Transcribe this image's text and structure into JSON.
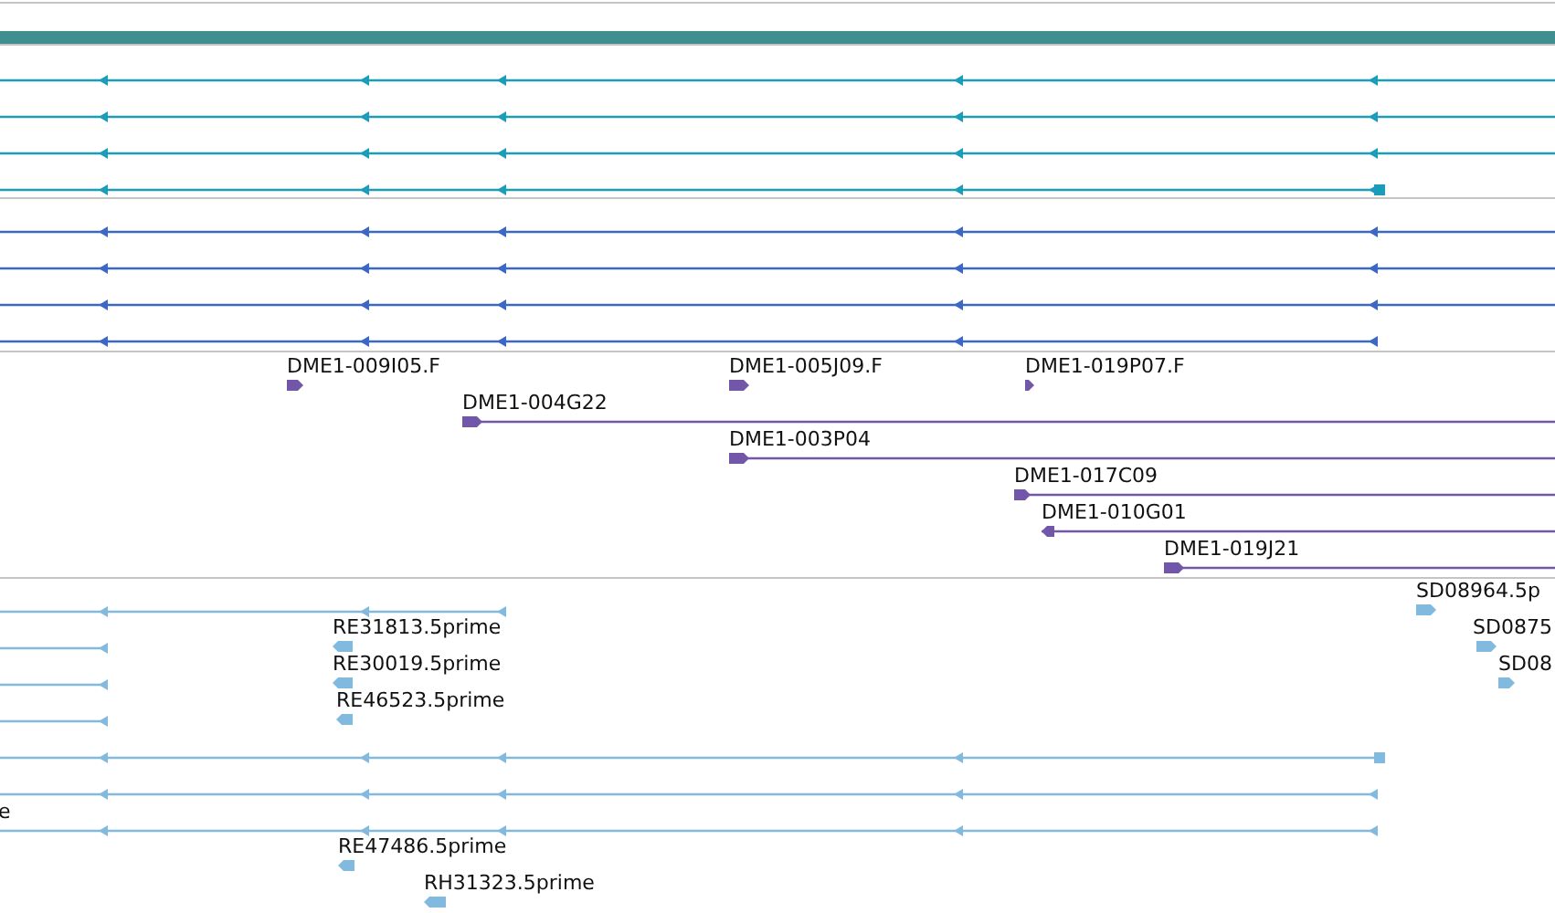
{
  "tracks": [
    {
      "color": "#1b9cb8",
      "features": [
        {
          "reverse": true
        },
        {
          "reverse": true
        },
        {
          "reverse": true
        },
        {
          "reverse": true
        }
      ]
    },
    {
      "color": "#3b68c4",
      "features": [
        {
          "reverse": true
        },
        {
          "reverse": true
        },
        {
          "reverse": true
        },
        {
          "reverse": true
        }
      ]
    },
    {
      "color": "#7257a9",
      "features": [
        {
          "label": "DME1-009I05.F",
          "reverse": false
        },
        {
          "label": "DME1-005J09.F",
          "reverse": false
        },
        {
          "label": "DME1-019P07.F",
          "reverse": false
        },
        {
          "label": "DME1-004G22",
          "reverse": false
        },
        {
          "label": "DME1-003P04",
          "reverse": false
        },
        {
          "label": "DME1-017C09",
          "reverse": false
        },
        {
          "label": "DME1-010G01",
          "reverse": true
        },
        {
          "label": "DME1-019J21",
          "reverse": false
        }
      ]
    },
    {
      "color": "#82b9df",
      "features": [
        {
          "label": "SD08964.5p",
          "reverse": false
        },
        {
          "reverse": true
        },
        {
          "label": "RE31813.5prime",
          "reverse": true
        },
        {
          "label": "SD0875",
          "reverse": false
        },
        {
          "reverse": true
        },
        {
          "label": "RE30019.5prime",
          "reverse": true
        },
        {
          "label": "SD08",
          "reverse": false
        },
        {
          "reverse": true
        },
        {
          "label": "RE46523.5prime",
          "reverse": true
        },
        {
          "reverse": true
        },
        {
          "reverse": true
        },
        {
          "reverse": true
        },
        {
          "label": "e",
          "reverse": true
        },
        {
          "label": "RE47486.5prime",
          "reverse": true
        },
        {
          "label": "RH31323.5prime",
          "reverse": true
        }
      ]
    }
  ]
}
